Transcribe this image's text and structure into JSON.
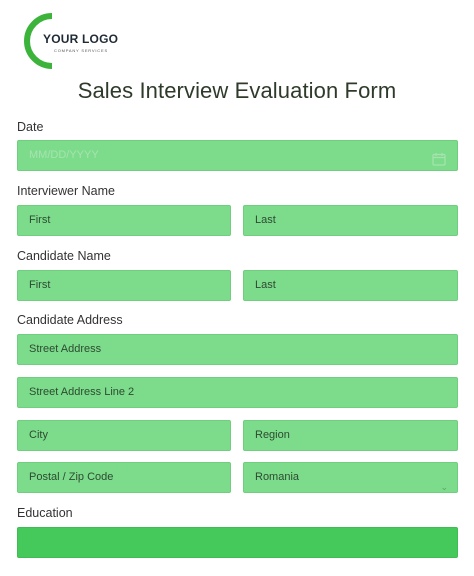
{
  "logo": {
    "text": "YOUR LOGO",
    "subtext": "COMPANY SERVICES"
  },
  "title": "Sales Interview Evaluation Form",
  "date": {
    "label": "Date",
    "mm": "MM",
    "dd": "DD",
    "yyyy": "YYYY",
    "sep": "/"
  },
  "interviewer": {
    "label": "Interviewer Name",
    "first": "First",
    "last": "Last"
  },
  "candidate": {
    "label": "Candidate Name",
    "first": "First",
    "last": "Last"
  },
  "address": {
    "label": "Candidate Address",
    "street": "Street Address",
    "street2": "Street Address Line 2",
    "city": "City",
    "region": "Region",
    "postal": "Postal / Zip Code",
    "country": "Romania"
  },
  "education": {
    "label": "Education",
    "value": ""
  },
  "colors": {
    "field": "#7ddc8c",
    "field_active": "#45c95a",
    "logo_green": "#3cb43c"
  }
}
